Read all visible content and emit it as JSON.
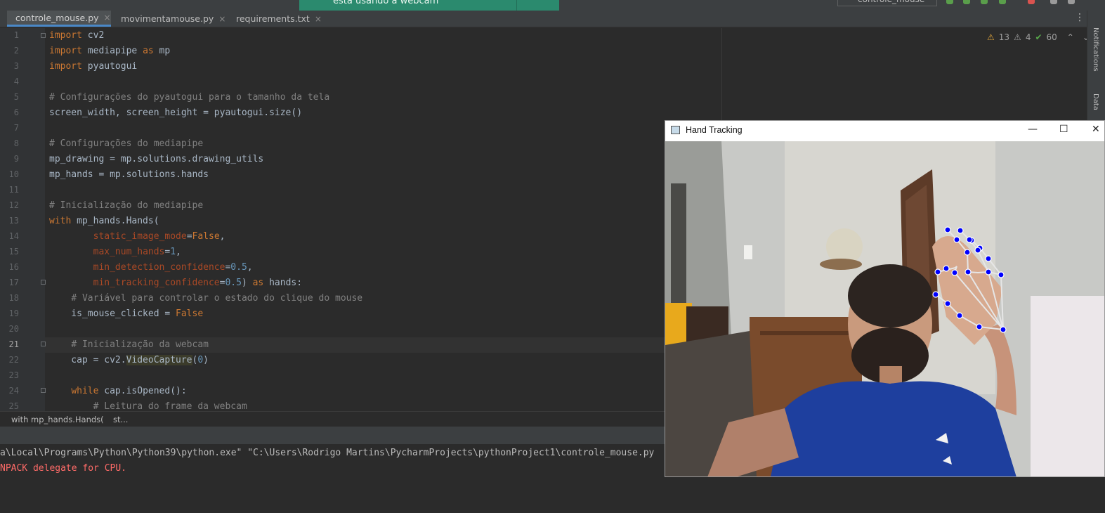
{
  "tabs": [
    {
      "label": "controle_mouse.py",
      "active": true,
      "icon": "python-file-icon"
    },
    {
      "label": "movimentamouse.py",
      "active": false,
      "icon": "python-file-icon"
    },
    {
      "label": "requirements.txt",
      "active": false,
      "icon": "text-file-icon"
    }
  ],
  "toast": {
    "text": "está usando a webcam"
  },
  "toolbar": {
    "run_config": "controle_mouse"
  },
  "inspections": {
    "warnings": "13",
    "weak_warnings": "4",
    "typos": "60"
  },
  "side_panels": {
    "notifications": "Notifications",
    "database": "Data"
  },
  "editor": {
    "line_numbers": [
      "1",
      "2",
      "3",
      "4",
      "5",
      "6",
      "7",
      "8",
      "9",
      "10",
      "11",
      "12",
      "13",
      "14",
      "15",
      "16",
      "17",
      "18",
      "19",
      "20",
      "21",
      "22",
      "23",
      "24",
      "25"
    ],
    "current_line": "21",
    "lines": [
      "import cv2",
      "import mediapipe as mp",
      "import pyautogui",
      "",
      "# Configurações do pyautogui para o tamanho da tela",
      "screen_width, screen_height = pyautogui.size()",
      "",
      "# Configurações do mediapipe",
      "mp_drawing = mp.solutions.drawing_utils",
      "mp_hands = mp.solutions.hands",
      "",
      "# Inicialização do mediapipe",
      "with mp_hands.Hands(",
      "        static_image_mode=False,",
      "        max_num_hands=1,",
      "        min_detection_confidence=0.5,",
      "        min_tracking_confidence=0.5) as hands:",
      "    # Variável para controlar o estado do clique do mouse",
      "    is_mouse_clicked = False",
      "",
      "    # Inicialização da webcam",
      "    cap = cv2.VideoCapture(0)",
      "",
      "    while cap.isOpened():",
      "        # Leitura do frame da webcam"
    ]
  },
  "breadcrumb": {
    "item1": "with mp_hands.Hands(",
    "item2": "st..."
  },
  "console": {
    "line1": "a\\Local\\Programs\\Python\\Python39\\python.exe\" \"C:\\Users\\Rodrigo Martins\\PycharmProjects\\pythonProject1\\controle_mouse.py",
    "line2": "NPACK delegate for CPU.",
    "line2_color": "#ff6b68"
  },
  "hand_window": {
    "title": "Hand Tracking",
    "minimize": "—",
    "maximize": "☐",
    "close": "✕"
  },
  "colors": {
    "accent": "#4a88c7",
    "toast_bg": "#2b8a6e",
    "landmark": "#0000ff"
  }
}
